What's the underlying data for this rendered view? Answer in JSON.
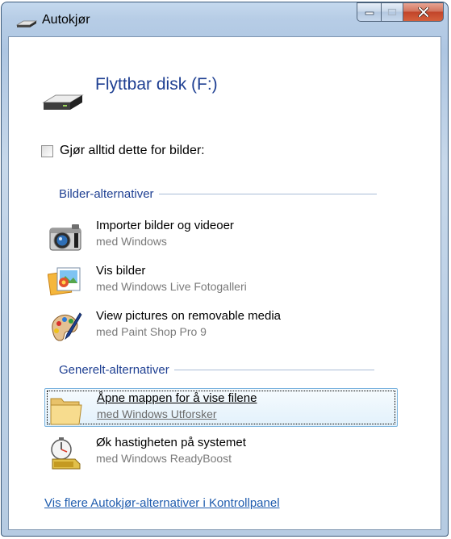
{
  "window": {
    "title": "Autokjør"
  },
  "device": {
    "title": "Flyttbar disk (F:)"
  },
  "always_checkbox": {
    "label": "Gjør alltid dette for bilder:",
    "checked": false
  },
  "sections": [
    {
      "title": "Bilder-alternativer",
      "items": [
        {
          "icon": "camera-icon",
          "action": "Importer bilder og videoer",
          "provider": "med Windows"
        },
        {
          "icon": "photo-gallery-icon",
          "action": "Vis bilder",
          "provider": "med Windows Live Fotogalleri"
        },
        {
          "icon": "paint-palette-icon",
          "action": "View pictures on removable media",
          "provider": "med Paint Shop Pro 9"
        }
      ]
    },
    {
      "title": "Generelt-alternativer",
      "items": [
        {
          "icon": "folder-icon",
          "action": "Åpne mappen for å vise filene",
          "provider": "med Windows Utforsker",
          "selected": true
        },
        {
          "icon": "readyboost-icon",
          "action": "Øk hastigheten på systemet",
          "provider": "med Windows ReadyBoost"
        }
      ]
    }
  ],
  "footer": {
    "link": "Vis flere Autokjør-alternativer i Kontrollpanel"
  },
  "colors": {
    "heading": "#1e3f92",
    "link": "#1f5cae",
    "close": "#c2452a"
  }
}
